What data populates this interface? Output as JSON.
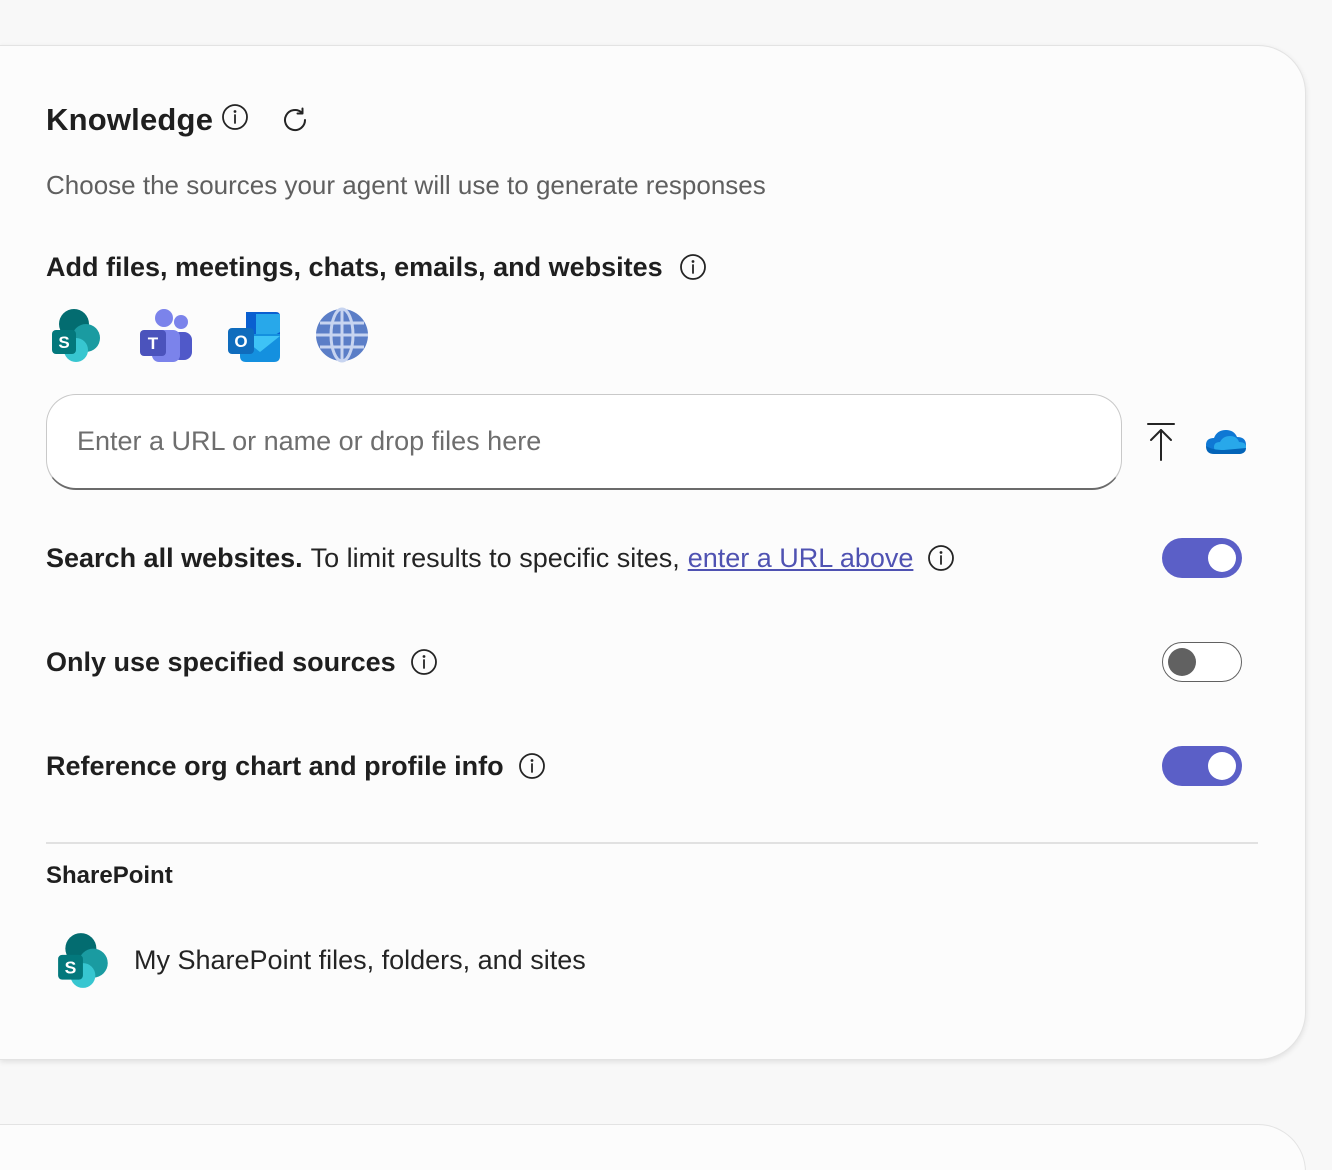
{
  "knowledge": {
    "title": "Knowledge",
    "subtitle": "Choose the sources your agent will use to generate responses",
    "add_heading": "Add files, meetings, chats, emails, and websites",
    "sources": [
      {
        "name": "SharePoint",
        "icon": "sharepoint-icon"
      },
      {
        "name": "Teams",
        "icon": "teams-icon"
      },
      {
        "name": "Outlook",
        "icon": "outlook-icon"
      },
      {
        "name": "Web",
        "icon": "globe-icon"
      }
    ],
    "url_input": {
      "placeholder": "Enter a URL or name or drop files here",
      "value": ""
    }
  },
  "settings": {
    "search_websites": {
      "bold": "Search all websites.",
      "text": "To limit results to specific sites,",
      "link": "enter a URL above",
      "enabled": true
    },
    "specified_sources": {
      "label": "Only use specified sources",
      "enabled": false
    },
    "org_chart": {
      "label": "Reference org chart and profile info",
      "enabled": true
    }
  },
  "sharepoint": {
    "heading": "SharePoint",
    "item_label": "My SharePoint files, folders, and sites"
  },
  "colors": {
    "accent": "#5b5fc7",
    "link": "#4f52b2"
  }
}
